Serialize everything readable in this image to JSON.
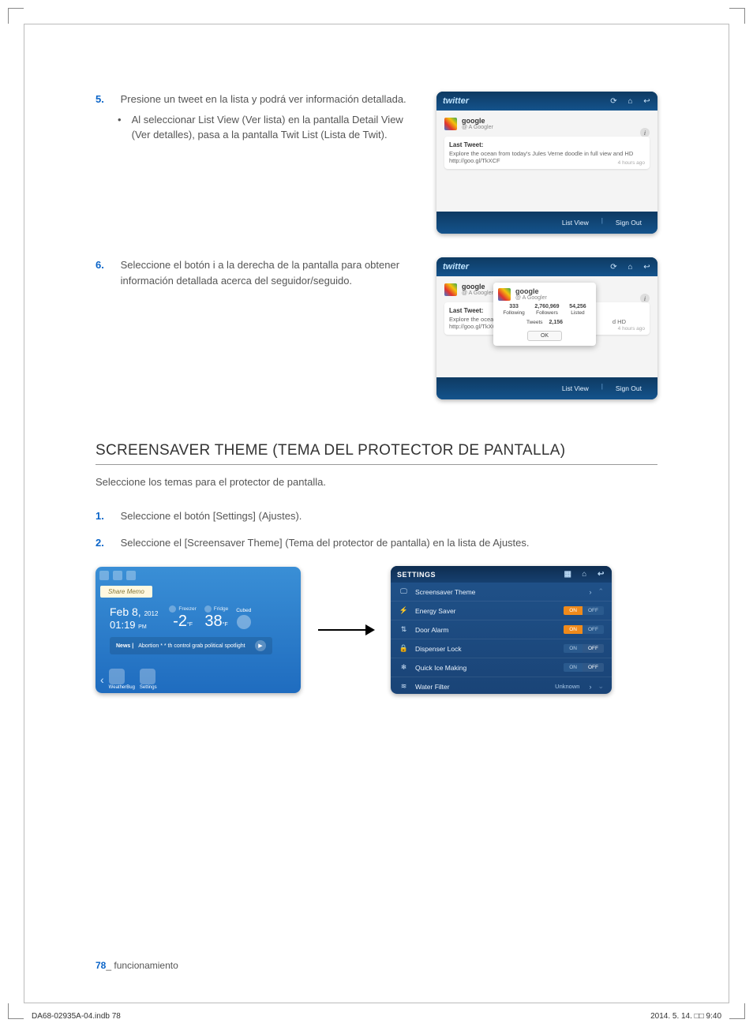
{
  "step5": {
    "num": "5.",
    "text": "Presione un tweet en la lista y podrá ver información detallada.",
    "bullet": "Al seleccionar List View (Ver lista) en la pantalla Detail View (Ver detalles), pasa a la pantalla Twit List (Lista de Twit)."
  },
  "step6": {
    "num": "6.",
    "text": "Seleccione el botón i a la derecha de la pantalla para obtener información detallada acerca del seguidor/seguido."
  },
  "twitter": {
    "logo": "twitter",
    "profile_name": "google",
    "profile_sub": "@ A Googler",
    "info_btn": "i",
    "tweet_title": "Last Tweet:",
    "tweet_body": "Explore the ocean from today's Jules Verne doodle in full view and HD http://goo.gl/TkXCF",
    "time": "4 hours ago",
    "list_view": "List View",
    "sign_out": "Sign Out",
    "popup": {
      "name": "google",
      "sub": "@ A Googler",
      "stats_following": "333",
      "stats_following_label": "Following",
      "stats_followers": "2,760,969",
      "stats_followers_label": "Followers",
      "stats_listed": "54,256",
      "stats_listed_label": "Listed",
      "tweets_label": "Tweets",
      "tweets_val": "2,156",
      "ok": "OK"
    },
    "tweet_body_short": "Explore the ocean",
    "tweet_url_short": "http://goo.gl/TkXC",
    "hd_text": "d HD"
  },
  "section": {
    "title": "SCREENSAVER THEME (TEMA DEL PROTECTOR DE PANTALLA)",
    "sub": "Seleccione los temas para el protector de pantalla.",
    "step1_num": "1.",
    "step1_text": "Seleccione el botón [Settings] (Ajustes).",
    "step2_num": "2.",
    "step2_text": "Seleccione el [Screensaver Theme] (Tema del protector de pantalla) en la lista de Ajustes."
  },
  "home": {
    "memo": "Share\nMemo",
    "date_month": "Feb 8,",
    "date_year": "2012",
    "time": "01:19",
    "time_suffix": "PM",
    "freezer_label": "Freezer",
    "freezer_val": "-2",
    "freezer_unit": "°F",
    "fridge_label": "Fridge",
    "fridge_val": "38",
    "fridge_unit": "°F",
    "cubed_label": "Cubed",
    "news_prefix": "News |",
    "news_text": "Abortion * * th control grab political spotlight",
    "news_play": "▶",
    "app1": "WeatherBug",
    "app2": "Settings"
  },
  "settings": {
    "header": "SETTINGS",
    "items": [
      {
        "label": "Screensaver Theme",
        "icon": "🖵",
        "type": "chevron"
      },
      {
        "label": "Energy Saver",
        "icon": "⚡",
        "type": "toggle",
        "state": "ON"
      },
      {
        "label": "Door Alarm",
        "icon": "⇅",
        "type": "toggle",
        "state": "ON"
      },
      {
        "label": "Dispenser Lock",
        "icon": "🔒",
        "type": "toggle",
        "state": "OFF"
      },
      {
        "label": "Quick Ice Making",
        "icon": "❄",
        "type": "toggle",
        "state": "OFF"
      },
      {
        "label": "Water Filter",
        "icon": "≋",
        "type": "text",
        "value": "Unknown"
      }
    ],
    "on": "ON",
    "off": "OFF"
  },
  "footer": {
    "page": "78",
    "section": "_ funcionamiento"
  },
  "print": {
    "file": "DA68-02935A-04.indb   78",
    "date": "2014. 5. 14.   □□ 9:40"
  }
}
